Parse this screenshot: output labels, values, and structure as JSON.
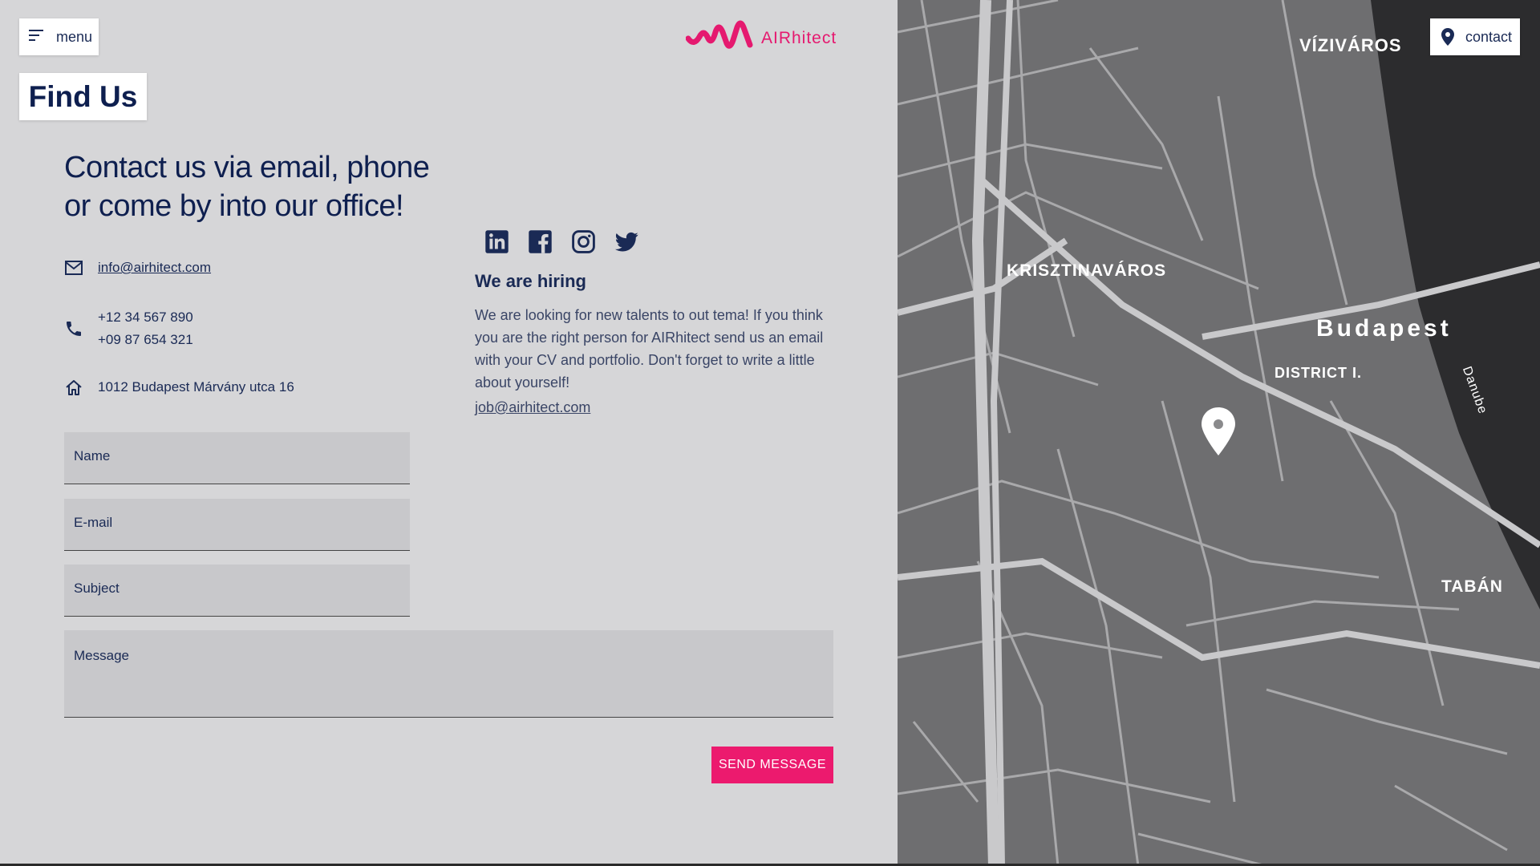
{
  "header": {
    "menu_label": "menu",
    "page_title": "Find Us",
    "brand": "AIRhitect",
    "contact_label": "contact"
  },
  "intro": {
    "headline_line1": "Contact us via email, phone",
    "headline_line2": "or come by into our office!"
  },
  "contact": {
    "email": "info@airhitect.com",
    "phone1": "+12 34 567 890",
    "phone2": "+09 87 654 321",
    "address": "1012 Budapest Márvány utca 16"
  },
  "form": {
    "name_placeholder": "Name",
    "email_placeholder": "E-mail",
    "subject_placeholder": "Subject",
    "message_placeholder": "Message",
    "send_label": "SEND MESSAGE"
  },
  "socials": [
    "linkedin-icon",
    "facebook-icon",
    "instagram-icon",
    "twitter-icon"
  ],
  "hiring": {
    "title": "We are hiring",
    "text": "We are looking for new talents to out tema! If you think you are the right person for AIRhitect send us an email with your CV and portfolio. Don't forget to write a little about yourself!",
    "email": "job@airhitect.com"
  },
  "map": {
    "labels": {
      "viziváros": "VÍZIVÁROS",
      "krisztinavaros": "KRISZTINAVÁROS",
      "budapest": "Budapest",
      "district": "DISTRICT I.",
      "taban": "TABÁN",
      "danube": "Danube"
    }
  },
  "colors": {
    "accent": "#ec1a6e",
    "navy": "#0e1f4f",
    "background": "#d6d6d8"
  }
}
